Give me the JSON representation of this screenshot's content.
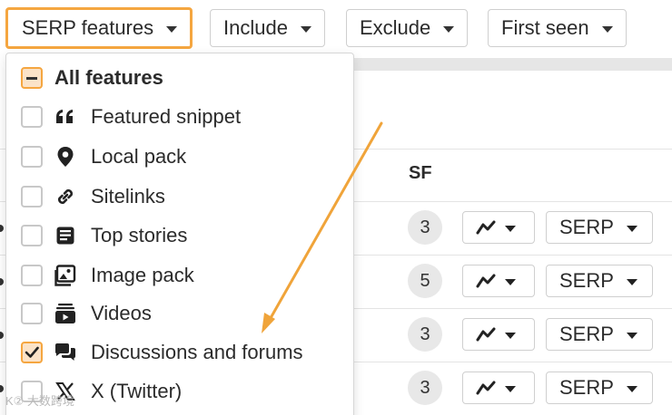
{
  "toolbar": {
    "serp_features": "SERP features",
    "include": "Include",
    "exclude": "Exclude",
    "first_seen": "First seen"
  },
  "table": {
    "sf_header": "SF",
    "rows": [
      {
        "sf": "3",
        "serp": "SERP"
      },
      {
        "sf": "5",
        "serp": "SERP"
      },
      {
        "sf": "3",
        "serp": "SERP"
      },
      {
        "sf": "3",
        "serp": "SERP"
      }
    ]
  },
  "dropdown": {
    "all": "All features",
    "options": [
      {
        "label": "Featured snippet",
        "icon": "quote-icon",
        "checked": false
      },
      {
        "label": "Local pack",
        "icon": "map-pin-icon",
        "checked": false
      },
      {
        "label": "Sitelinks",
        "icon": "link-icon",
        "checked": false
      },
      {
        "label": "Top stories",
        "icon": "newspaper-icon",
        "checked": false
      },
      {
        "label": "Image pack",
        "icon": "image-icon",
        "checked": false
      },
      {
        "label": "Videos",
        "icon": "video-icon",
        "checked": false
      },
      {
        "label": "Discussions and forums",
        "icon": "chat-bubbles-icon",
        "checked": true
      },
      {
        "label": "X (Twitter)",
        "icon": "x-twitter-icon",
        "checked": false
      }
    ]
  },
  "watermark": "K② 大数跨境",
  "colors": {
    "accent": "#f5a640",
    "arrow": "#f0a43a",
    "check_bg": "#fbe3c8"
  }
}
